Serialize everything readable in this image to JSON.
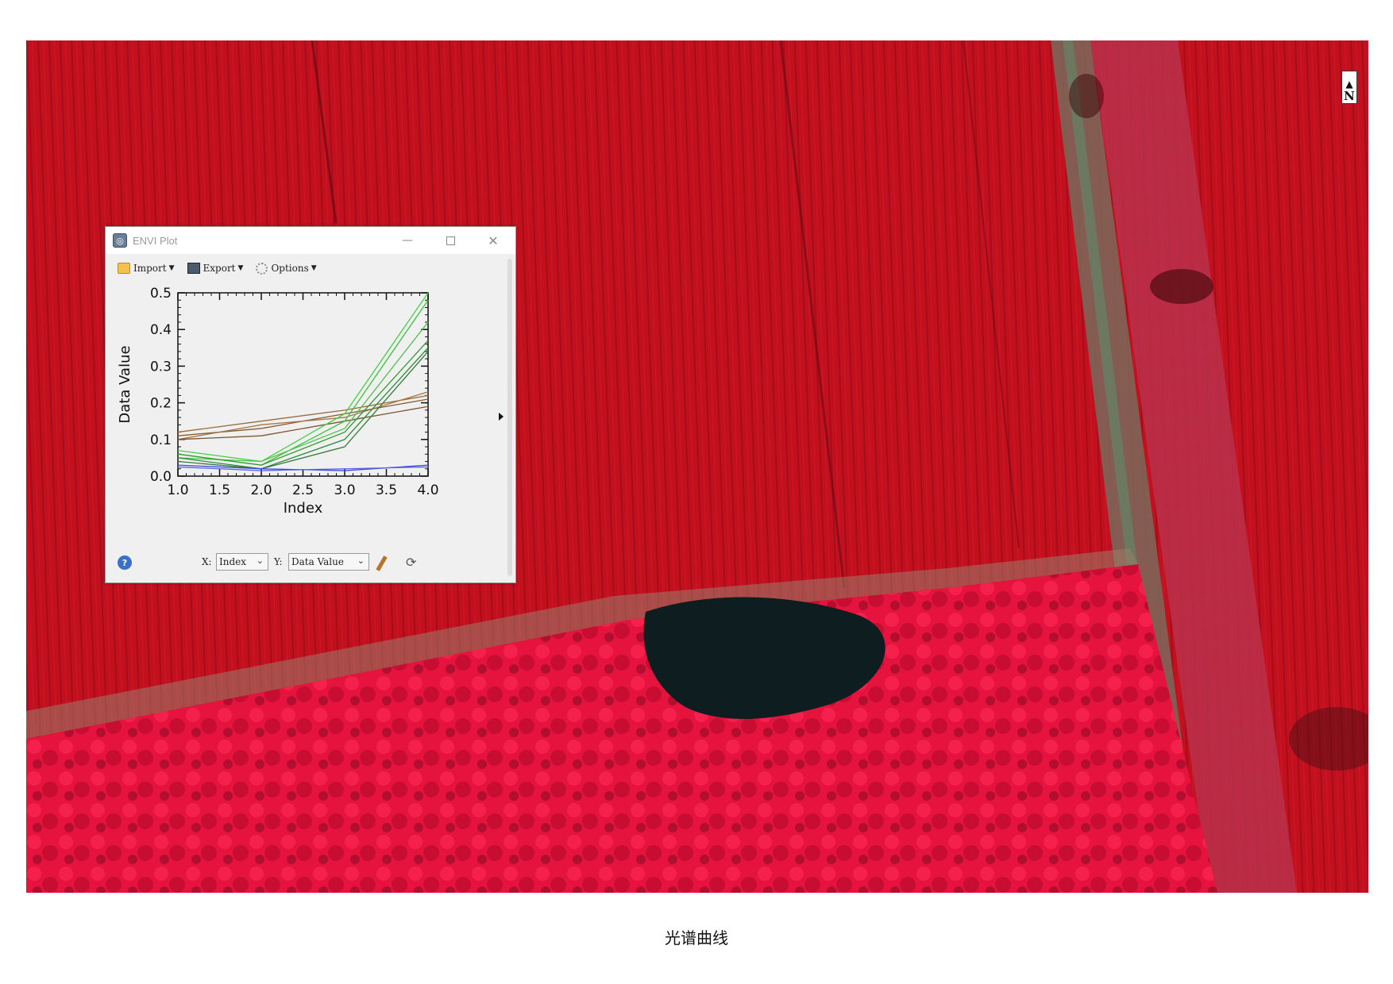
{
  "caption": "光谱曲线",
  "map": {
    "north_label": "N"
  },
  "window": {
    "title": "ENVI Plot",
    "icon": "envi-app-icon",
    "controls": [
      "minimize-icon",
      "maximize-icon",
      "close-icon"
    ]
  },
  "toolbar": {
    "import_label": "Import",
    "export_label": "Export",
    "options_label": "Options"
  },
  "bottom_bar": {
    "x_label": "X:",
    "x_value": "Index",
    "y_label": "Y:",
    "y_value": "Data Value",
    "help_icon": "help-icon",
    "style_icon": "pen-icon",
    "refresh_icon": "refresh-icon"
  },
  "chart_data": {
    "type": "line",
    "title": "",
    "xlabel": "Index",
    "ylabel": "Data Value",
    "x": [
      1.0,
      2.0,
      3.0,
      4.0
    ],
    "xlim": [
      1.0,
      4.0
    ],
    "ylim": [
      0.0,
      0.5
    ],
    "xticks": [
      "1.0",
      "1.5",
      "2.0",
      "2.5",
      "3.0",
      "3.5",
      "4.0"
    ],
    "yticks": [
      "0.0",
      "0.1",
      "0.2",
      "0.3",
      "0.4",
      "0.5"
    ],
    "grid": false,
    "series": [
      {
        "color": "#9a6a3a",
        "values": [
          0.12,
          0.15,
          0.18,
          0.22
        ]
      },
      {
        "color": "#8a5a30",
        "values": [
          0.11,
          0.13,
          0.17,
          0.21
        ]
      },
      {
        "color": "#a0764a",
        "values": [
          0.1,
          0.14,
          0.16,
          0.23
        ]
      },
      {
        "color": "#7a5530",
        "values": [
          0.1,
          0.11,
          0.15,
          0.19
        ]
      },
      {
        "color": "#44d044",
        "values": [
          0.07,
          0.04,
          0.17,
          0.5
        ]
      },
      {
        "color": "#3cc03c",
        "values": [
          0.06,
          0.03,
          0.15,
          0.48
        ]
      },
      {
        "color": "#50c050",
        "values": [
          0.05,
          0.04,
          0.13,
          0.42
        ]
      },
      {
        "color": "#2e9a2e",
        "values": [
          0.06,
          0.03,
          0.12,
          0.37
        ]
      },
      {
        "color": "#2a8a3a",
        "values": [
          0.05,
          0.02,
          0.1,
          0.35
        ]
      },
      {
        "color": "#357a35",
        "values": [
          0.04,
          0.02,
          0.08,
          0.34
        ]
      },
      {
        "color": "#3a48d8",
        "values": [
          0.03,
          0.02,
          0.015,
          0.03
        ]
      },
      {
        "color": "#5a64e0",
        "values": [
          0.025,
          0.015,
          0.02,
          0.025
        ]
      }
    ]
  }
}
